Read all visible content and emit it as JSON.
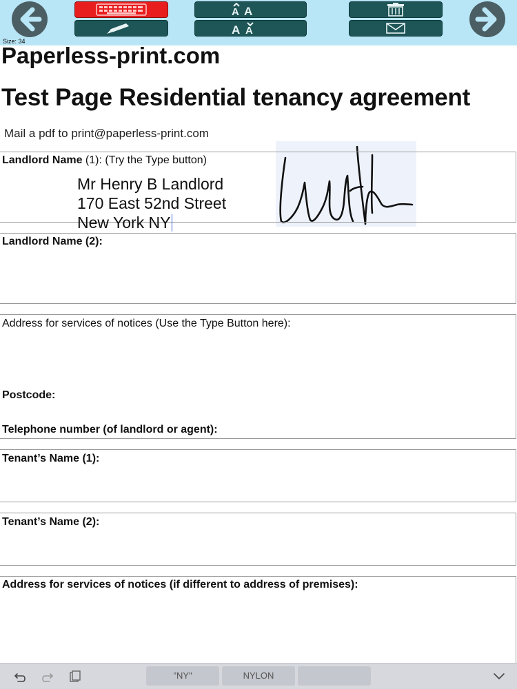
{
  "toolbar": {
    "size_label": "Size: 34",
    "buttons": [
      "back",
      "keyboard",
      "pencil",
      "increase-font",
      "decrease-font",
      "trash",
      "mail",
      "forward"
    ]
  },
  "document": {
    "title": "Paperless-print.com",
    "subtitle": "Test Page Residential tenancy agreement",
    "mail_line": "Mail a pdf to print@paperless-print.com",
    "landlord1_label_bold": "Landlord Name",
    "landlord1_label_rest": " (1): (Try the Type button)",
    "landlord1_lines": [
      "Mr Henry B Landlord",
      "170 East 52nd Street",
      "New York NY"
    ],
    "landlord2_label": "Landlord Name (2):",
    "address_label": "Address for services of notices (Use the Type Button here):",
    "postcode_label": "Postcode:",
    "telephone_label": "Telephone number (of landlord or agent):",
    "tenant1_label": "Tenant’s Name (1):",
    "tenant2_label": "Tenant’s Name (2):",
    "address2_label": "Address for services of notices (if different to address of premises):"
  },
  "keyboard_bar": {
    "suggestions": [
      "\"NY\"",
      "NYLON",
      ""
    ]
  },
  "colors": {
    "toolbar_bg": "#b9e6f7",
    "button_dark": "#1e5557",
    "button_active": "#e81e1e",
    "nav_circle": "#4a5e63"
  }
}
